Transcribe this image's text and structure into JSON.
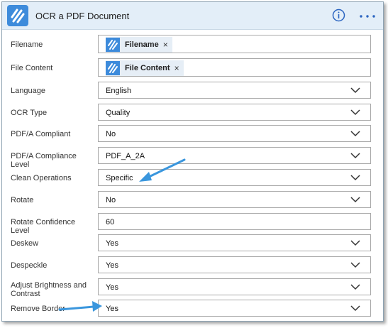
{
  "header": {
    "title": "OCR a PDF Document",
    "info_icon": "info-icon",
    "more_icon": "more-options-icon"
  },
  "colors": {
    "header_bg": "#e3eef8",
    "accent": "#2a64c0",
    "token_icon": "#3d8bdb",
    "annotation_arrow": "#3a96dd"
  },
  "fields": [
    {
      "label": "Filename",
      "type": "token",
      "token_label": "Filename",
      "token_remove": "×"
    },
    {
      "label": "File Content",
      "type": "token",
      "token_label": "File Content",
      "token_remove": "×"
    },
    {
      "label": "Language",
      "type": "select",
      "value": "English"
    },
    {
      "label": "OCR Type",
      "type": "select",
      "value": "Quality"
    },
    {
      "label": "PDF/A Compliant",
      "type": "select",
      "value": "No"
    },
    {
      "label": "PDF/A Compliance Level",
      "type": "select",
      "value": "PDF_A_2A"
    },
    {
      "label": "Clean Operations",
      "type": "select",
      "value": "Specific"
    },
    {
      "label": "Rotate",
      "type": "select",
      "value": "No"
    },
    {
      "label": "Rotate Confidence Level",
      "type": "input",
      "value": "60"
    },
    {
      "label": "Deskew",
      "type": "select",
      "value": "Yes"
    },
    {
      "label": "Despeckle",
      "type": "select",
      "value": "Yes"
    },
    {
      "label": "Adjust Brightness and Contrast",
      "type": "select",
      "value": "Yes"
    },
    {
      "label": "Remove Border",
      "type": "select",
      "value": "Yes"
    }
  ]
}
